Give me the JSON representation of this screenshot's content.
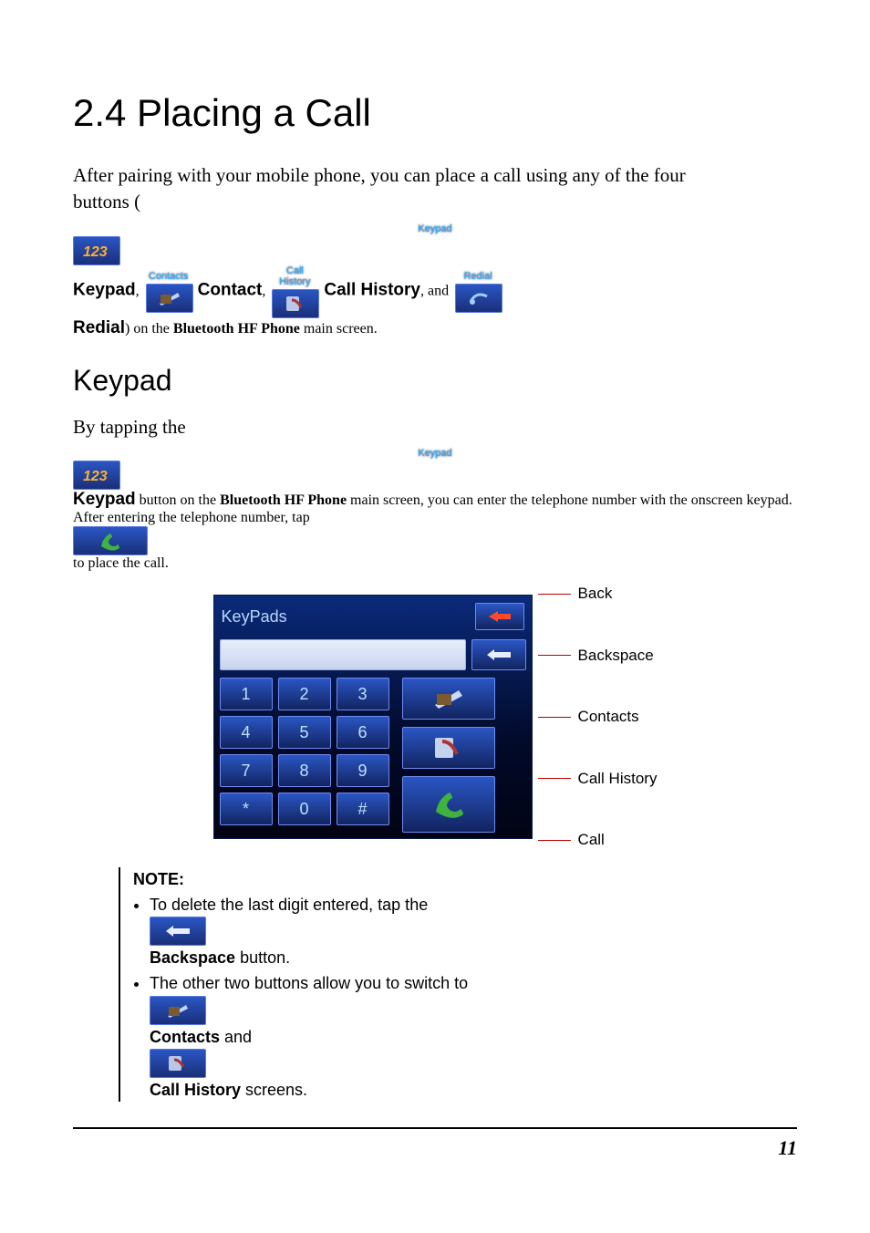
{
  "section_title": "2.4   Placing a Call",
  "intro": {
    "line1": "After pairing with your mobile phone, you can place a call using any of the four",
    "buttons_open": "buttons (",
    "btn_keypad": "Keypad",
    "sep1": ", ",
    "btn_contact": "Contact",
    "sep2": ", ",
    "btn_callhistory": "Call History",
    "sep3": ", and ",
    "btn_redial": "Redial",
    "line3a": ") on the ",
    "app_name": "Bluetooth HF Phone",
    "line3b": " main screen."
  },
  "chip_labels": {
    "keypad": "Keypad",
    "contacts": "Contacts",
    "callhistory": "Call History",
    "redial": "Redial"
  },
  "keypad_section": {
    "heading": "Keypad",
    "p1a": "By tapping the",
    "p1b_btn": "Keypad",
    "p1c": " button on the ",
    "p1d_app": "Bluetooth HF Phone",
    "p1e": " main screen, you can enter the telephone number with the onscreen keypad. After entering the telephone number, tap ",
    "p1f": " to place the call."
  },
  "screen": {
    "title": "KeyPads",
    "keys": [
      "1",
      "2",
      "3",
      "4",
      "5",
      "6",
      "7",
      "8",
      "9",
      "*",
      "0",
      "#"
    ]
  },
  "callouts": {
    "back": "Back",
    "backspace": "Backspace",
    "contacts": "Contacts",
    "callhistory": "Call History",
    "call": "Call"
  },
  "note": {
    "title": "NOTE:",
    "li1a": "To delete the last digit entered, tap the ",
    "li1b": "Backspace",
    "li1c": " button.",
    "li2a": "The other two buttons allow you to switch to ",
    "li2b": "Contacts",
    "li2c": " and ",
    "li2d": "Call History",
    "li2e": " screens."
  },
  "page_number": "11"
}
